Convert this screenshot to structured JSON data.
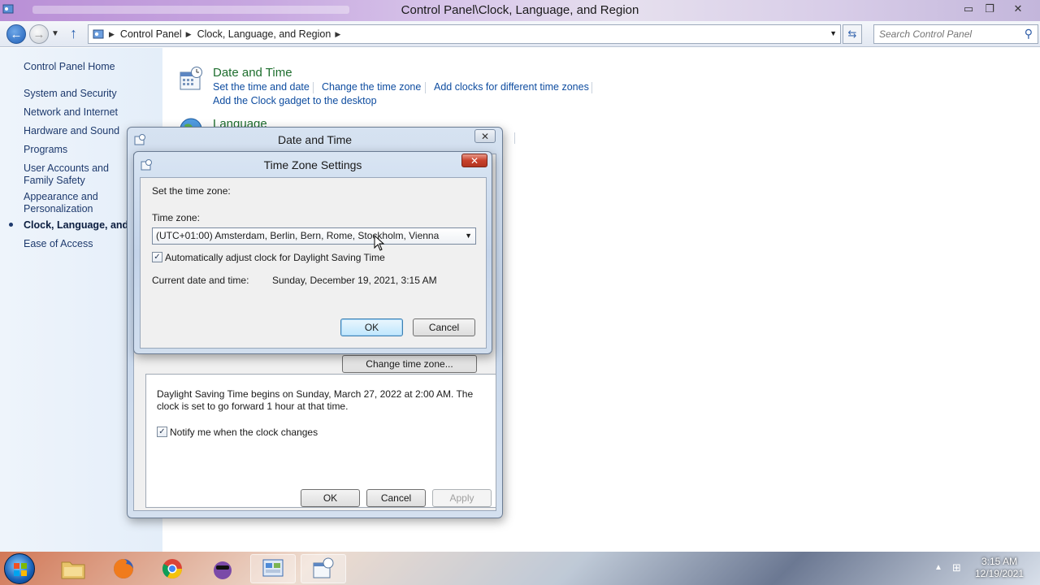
{
  "window": {
    "title": "Control Panel\\Clock, Language, and Region",
    "minimize": "▭",
    "restore": "❐",
    "close": "✕"
  },
  "address": {
    "crumbs": [
      "Control Panel",
      "Clock, Language, and Region"
    ],
    "search_placeholder": "Search Control Panel"
  },
  "leftnav": {
    "home": "Control Panel Home",
    "items": [
      "System and Security",
      "Network and Internet",
      "Hardware and Sound",
      "Programs",
      "User Accounts and Family Safety",
      "Appearance and Personalization",
      "Clock, Language, and Region",
      "Ease of Access"
    ]
  },
  "main": {
    "date_time": {
      "title": "Date and Time",
      "tasks": [
        "Set the time and date",
        "Change the time zone",
        "Add clocks for different time zones",
        "Add the Clock gadget to the desktop"
      ]
    },
    "language": {
      "title": "Language"
    }
  },
  "dt_dialog": {
    "title": "Date and Time",
    "change_tz_button": "Change time zone...",
    "dst_text_1": "Daylight Saving Time begins on Sunday, March 27, 2022 at 2:00 AM. The",
    "dst_text_2": "clock is set to go forward 1 hour at that time.",
    "notify_label": "Notify me when the clock changes",
    "ok": "OK",
    "cancel": "Cancel",
    "apply": "Apply"
  },
  "tz_dialog": {
    "title": "Time Zone Settings",
    "set_label": "Set the time zone:",
    "tz_label": "Time zone:",
    "tz_value": "(UTC+01:00) Amsterdam, Berlin, Bern, Rome, Stockholm, Vienna",
    "auto_dst_label": "Automatically adjust clock for Daylight Saving Time",
    "auto_dst_checked": true,
    "current_label": "Current date and time:",
    "current_value": "Sunday, December 19, 2021, 3:15 AM",
    "ok": "OK",
    "cancel": "Cancel"
  },
  "taskbar": {
    "time": "3:15 AM",
    "date": "12/19/2021"
  },
  "colors": {
    "link": "#0f4da0",
    "category_title": "#1e6e2e",
    "nav_link": "#1e3a6d"
  }
}
